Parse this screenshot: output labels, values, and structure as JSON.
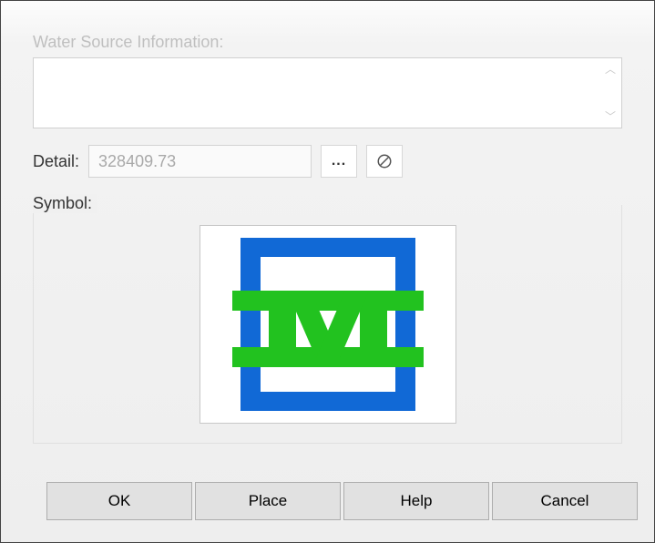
{
  "waterSource": {
    "label": "Water Source Information:",
    "text": ""
  },
  "detail": {
    "label": "Detail:",
    "value": "328409.73"
  },
  "symbol": {
    "label": "Symbol:"
  },
  "buttons": {
    "ok": "OK",
    "place": "Place",
    "help": "Help",
    "cancel": "Cancel",
    "browse": "...",
    "clear_tooltip": "Clear"
  }
}
